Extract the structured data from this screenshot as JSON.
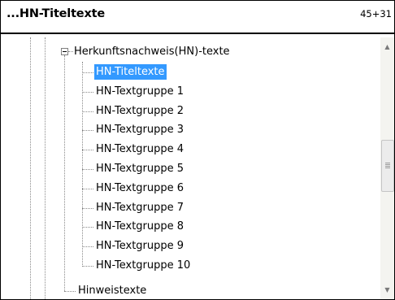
{
  "header": {
    "title": "...HN-Titeltexte",
    "counter": "45+31"
  },
  "tree": {
    "parent": {
      "label": "Herkunftsnachweis(HN)-texte",
      "expanded": true
    },
    "children": [
      {
        "label": "HN-Titeltexte",
        "selected": true
      },
      {
        "label": "HN-Textgruppe 1"
      },
      {
        "label": "HN-Textgruppe 2"
      },
      {
        "label": "HN-Textgruppe 3"
      },
      {
        "label": "HN-Textgruppe 4"
      },
      {
        "label": "HN-Textgruppe 5"
      },
      {
        "label": "HN-Textgruppe 6"
      },
      {
        "label": "HN-Textgruppe 7"
      },
      {
        "label": "HN-Textgruppe 8"
      },
      {
        "label": "HN-Textgruppe 9"
      },
      {
        "label": "HN-Textgruppe 10"
      }
    ],
    "sibling": {
      "label": "Hinweistexte"
    }
  },
  "scrollbar": {
    "up_icon": "triangle-up-icon",
    "down_icon": "triangle-down-icon"
  },
  "colors": {
    "selection": "#3399ff",
    "selection_text": "#ffffff",
    "border": "#000000"
  }
}
